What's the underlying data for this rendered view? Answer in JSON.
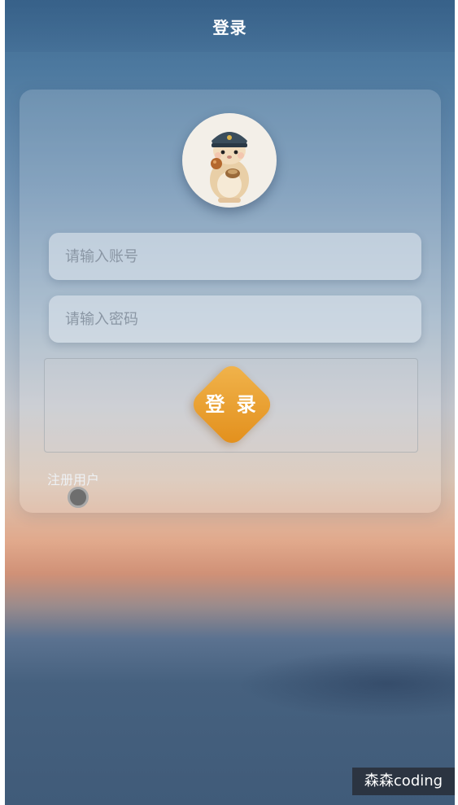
{
  "header": {
    "title": "登录"
  },
  "form": {
    "account_placeholder": "请输入账号",
    "password_placeholder": "请输入密码",
    "login_label": "登 录",
    "register_label": "注册用户"
  },
  "avatar": {
    "icon": "hamster-avatar-icon"
  },
  "watermark": {
    "text": "森森coding"
  },
  "colors": {
    "login_button": "#e8a030",
    "background_top": "#3e6a92",
    "background_sunset": "#e1a98c"
  }
}
